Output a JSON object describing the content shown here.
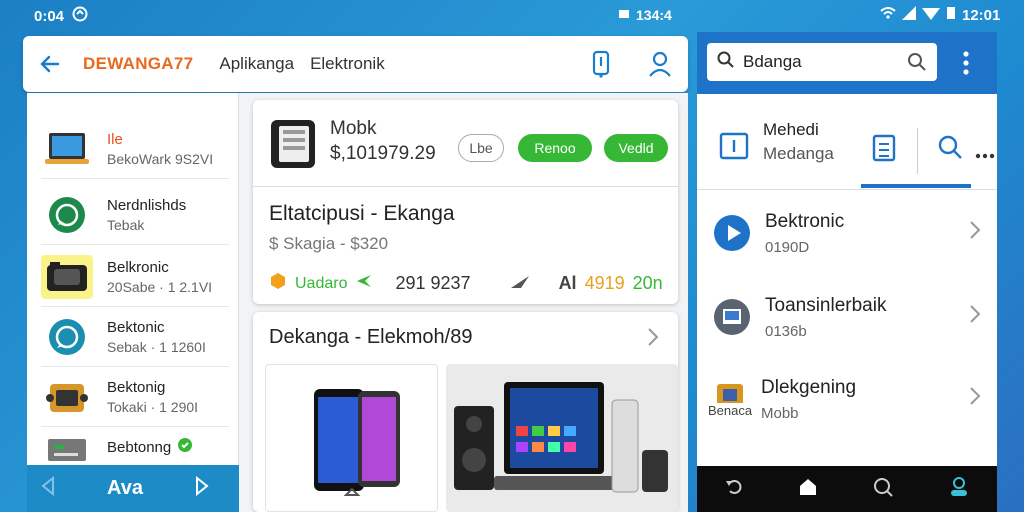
{
  "status": {
    "time_left": "0:04",
    "time_mid": "134:4",
    "time_right": "12:01"
  },
  "left_app": {
    "brand": "DEWANGA77",
    "tabs": [
      "Aplikanga",
      "Elektronik"
    ],
    "sidebar": [
      {
        "title": "Ile",
        "subtitle": "BekoWark 9S2VI",
        "icon": "laptop-icon"
      },
      {
        "title": "Nerdnlishds",
        "subtitle": "Tebak",
        "icon": "whatsapp-icon"
      },
      {
        "title": "Belkronic",
        "subtitle": "20Sabe · 1 2.1VI",
        "icon": "camera-icon"
      },
      {
        "title": "Bektonic",
        "subtitle": "Sebak · 1 1260I",
        "icon": "chat-icon"
      },
      {
        "title": "Bektonig",
        "subtitle": "Tokaki · 1 290I",
        "icon": "box-icon"
      },
      {
        "title": "Bebtonng",
        "subtitle": "",
        "icon": "router-icon"
      }
    ],
    "bottom_label": "Ava"
  },
  "card1": {
    "product_name": "Mobk",
    "price": "$,101979.29",
    "btn_outline": "Lbe",
    "btn_green1": "Renoo",
    "btn_green2": "Vedld",
    "title": "Eltatcipusi - Ekanga",
    "subtitle": "$ Skagia - $320",
    "footer_label": "Uadaro",
    "footer_num": "291 9237",
    "footer_a": "Al",
    "footer_num2": "4919",
    "footer_tail": "20n"
  },
  "card2": {
    "title": "Dekanga - Elekmoh/89"
  },
  "right_app": {
    "search_value": "Bdanga",
    "tab_title": "Mehedi",
    "tab_subtitle": "Medanga",
    "list": [
      {
        "title": "Bektronic",
        "subtitle": "0190D",
        "icon": "play-icon"
      },
      {
        "title": "Toansinlerbaik",
        "subtitle": "0136b",
        "icon": "screen-icon"
      },
      {
        "title": "Dlekgening",
        "subtitle": "Mobb",
        "icon": "package-icon",
        "prefix": "Benaca"
      }
    ]
  },
  "colors": {
    "brand": "#e86a1e",
    "green": "#36b836",
    "blue": "#1e73c9",
    "teal": "#1d8bc6"
  }
}
